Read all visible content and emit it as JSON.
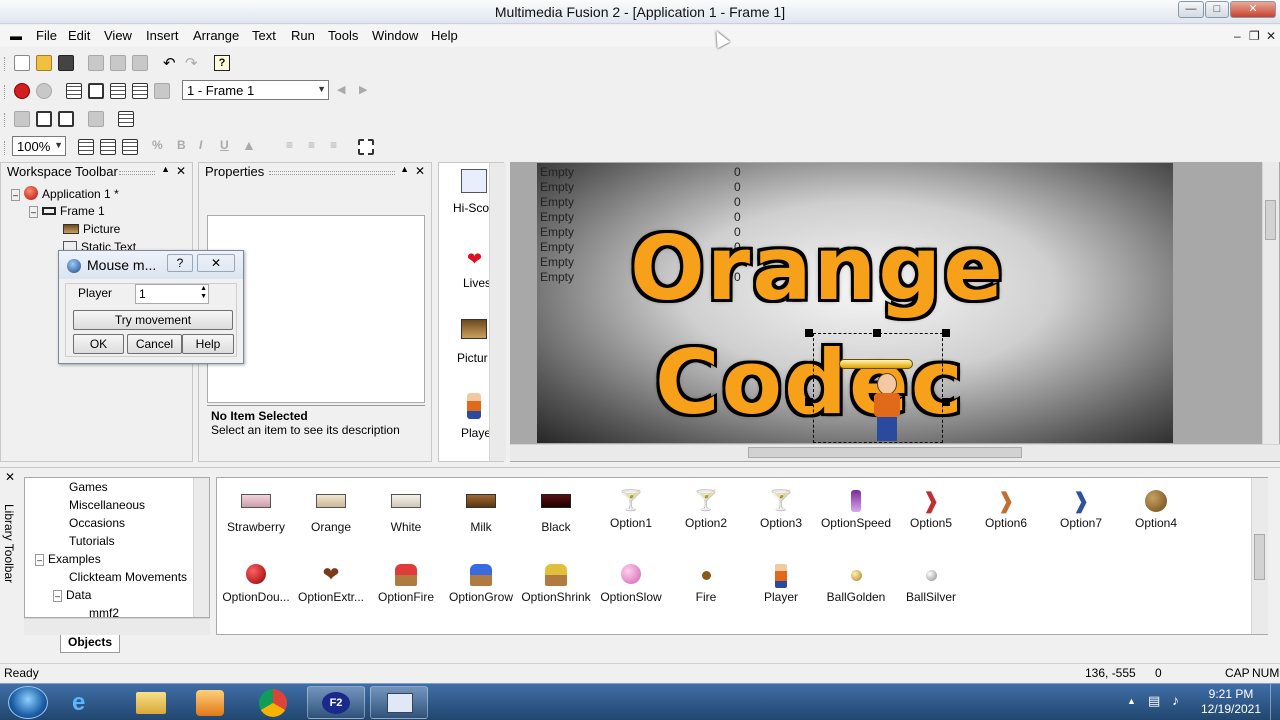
{
  "window": {
    "title": "Multimedia Fusion 2 - [Application 1 - Frame 1]"
  },
  "menu": [
    "File",
    "Edit",
    "View",
    "Insert",
    "Arrange",
    "Text",
    "Run",
    "Tools",
    "Window",
    "Help"
  ],
  "toolbar": {
    "frame_select": "1 - Frame 1",
    "zoom": "100%"
  },
  "workspace": {
    "title": "Workspace Toolbar",
    "tree": [
      {
        "label": "Application 1 *",
        "icon": "application-icon"
      },
      {
        "label": "Frame 1",
        "icon": "frame-icon"
      },
      {
        "label": "Picture",
        "icon": "picture-icon"
      },
      {
        "label": "Static Text",
        "icon": "text-icon"
      }
    ]
  },
  "properties": {
    "title": "Properties",
    "desc_title": "No Item Selected",
    "desc_text": "Select an item to see its description"
  },
  "dialog": {
    "title": "Mouse m...",
    "help_glyph": "?",
    "player_label": "Player",
    "player_value": "1",
    "try_button": "Try movement",
    "ok": "OK",
    "cancel": "Cancel",
    "help": "Help"
  },
  "object_strip": [
    {
      "label": "Hi-Sco",
      "icon": "hiscore-icon"
    },
    {
      "label": "Lives",
      "icon": "heart-icon"
    },
    {
      "label": "Pictur",
      "icon": "picture-icon"
    },
    {
      "label": "Playe",
      "icon": "player-icon"
    }
  ],
  "scene": {
    "hiscores": [
      {
        "name": "Empty",
        "score": "0"
      },
      {
        "name": "Empty",
        "score": "0"
      },
      {
        "name": "Empty",
        "score": "0"
      },
      {
        "name": "Empty",
        "score": "0"
      },
      {
        "name": "Empty",
        "score": "0"
      },
      {
        "name": "Empty",
        "score": "0"
      },
      {
        "name": "Empty",
        "score": "0"
      },
      {
        "name": "Empty",
        "score": "0"
      }
    ],
    "title_line1": "Orange",
    "title_line2": "Codec",
    "colors": {
      "text": "#f7a11a",
      "outline": "#000000"
    }
  },
  "library": {
    "tree": [
      {
        "label": "Games"
      },
      {
        "label": "Miscellaneous"
      },
      {
        "label": "Occasions"
      },
      {
        "label": "Tutorials"
      },
      {
        "label": "Examples"
      },
      {
        "label": "Clickteam Movements"
      },
      {
        "label": "Data"
      },
      {
        "label": "mmf2"
      }
    ],
    "tab": "Objects",
    "side_title": "Library Toolbar",
    "items_row1": [
      {
        "label": "Strawberry",
        "icon": "brick-pink-icon"
      },
      {
        "label": "Orange",
        "icon": "brick-beige-icon"
      },
      {
        "label": "White",
        "icon": "brick-white-icon"
      },
      {
        "label": "Milk",
        "icon": "brick-brown-icon"
      },
      {
        "label": "Black",
        "icon": "brick-black-icon"
      },
      {
        "label": "Option1",
        "icon": "cocktail-icon"
      },
      {
        "label": "Option2",
        "icon": "cocktail-icon"
      },
      {
        "label": "Option3",
        "icon": "cocktail-icon"
      },
      {
        "label": "OptionSpeed",
        "icon": "potion-icon"
      },
      {
        "label": "Option5",
        "icon": "candy-cane-icon"
      },
      {
        "label": "Option6",
        "icon": "candy-cane-icon"
      },
      {
        "label": "Option7",
        "icon": "candy-cane-icon"
      },
      {
        "label": "Option4",
        "icon": "nuts-icon"
      }
    ],
    "items_row2": [
      {
        "label": "OptionDou...",
        "icon": "cherry-icon"
      },
      {
        "label": "OptionExtr...",
        "icon": "heart-choc-icon"
      },
      {
        "label": "OptionFire",
        "icon": "muffin-red-icon"
      },
      {
        "label": "OptionGrow",
        "icon": "muffin-blue-icon"
      },
      {
        "label": "OptionShrink",
        "icon": "muffin-yellow-icon"
      },
      {
        "label": "OptionSlow",
        "icon": "candy-pink-icon"
      },
      {
        "label": "Fire",
        "icon": "dot-brown-icon"
      },
      {
        "label": "Player",
        "icon": "player-icon"
      },
      {
        "label": "BallGolden",
        "icon": "ball-gold-icon"
      },
      {
        "label": "BallSilver",
        "icon": "ball-silver-icon"
      }
    ]
  },
  "status": {
    "text": "Ready",
    "coords": "136, -555",
    "zero": "0",
    "caps": "CAP",
    "num": "NUM"
  },
  "taskbar": {
    "time": "9:21 PM",
    "date": "12/19/2021"
  }
}
